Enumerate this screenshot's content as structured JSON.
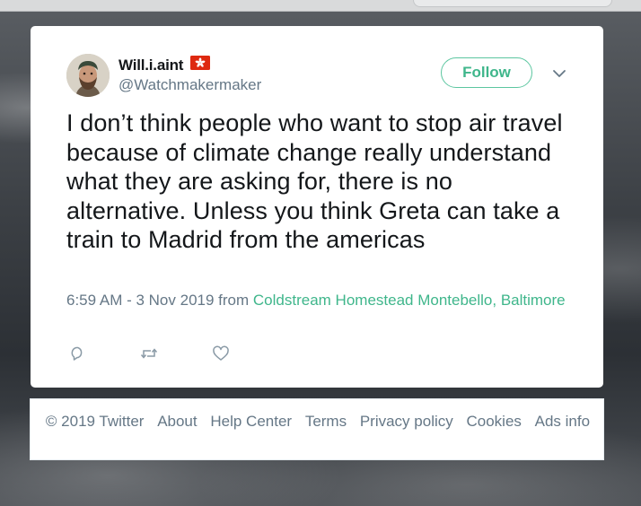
{
  "tweet": {
    "display_name": "Will.i.aint",
    "handle": "@Watchmakermaker",
    "follow_label": "Follow",
    "text": "I don’t think people who want to stop air travel because of climate change really understand what they are asking for, there is no alternative.  Unless you think Greta can take a train to Madrid from the americas",
    "timestamp": "6:59 AM - 3 Nov 2019",
    "from_word": "from",
    "location": "Coldstream Homestead Montebello, Baltimore",
    "icons": {
      "flag": "hong-kong-flag-icon",
      "menu": "chevron-down-icon",
      "reply": "reply-icon",
      "retweet": "retweet-icon",
      "like": "heart-icon"
    }
  },
  "footer": {
    "copyright": "© 2019 Twitter",
    "links": [
      "About",
      "Help Center",
      "Terms",
      "Privacy policy",
      "Cookies",
      "Ads info"
    ]
  },
  "colors": {
    "accent": "#3fb68b",
    "text": "#14171a",
    "muted": "#657786",
    "flag_red": "#de2910"
  }
}
